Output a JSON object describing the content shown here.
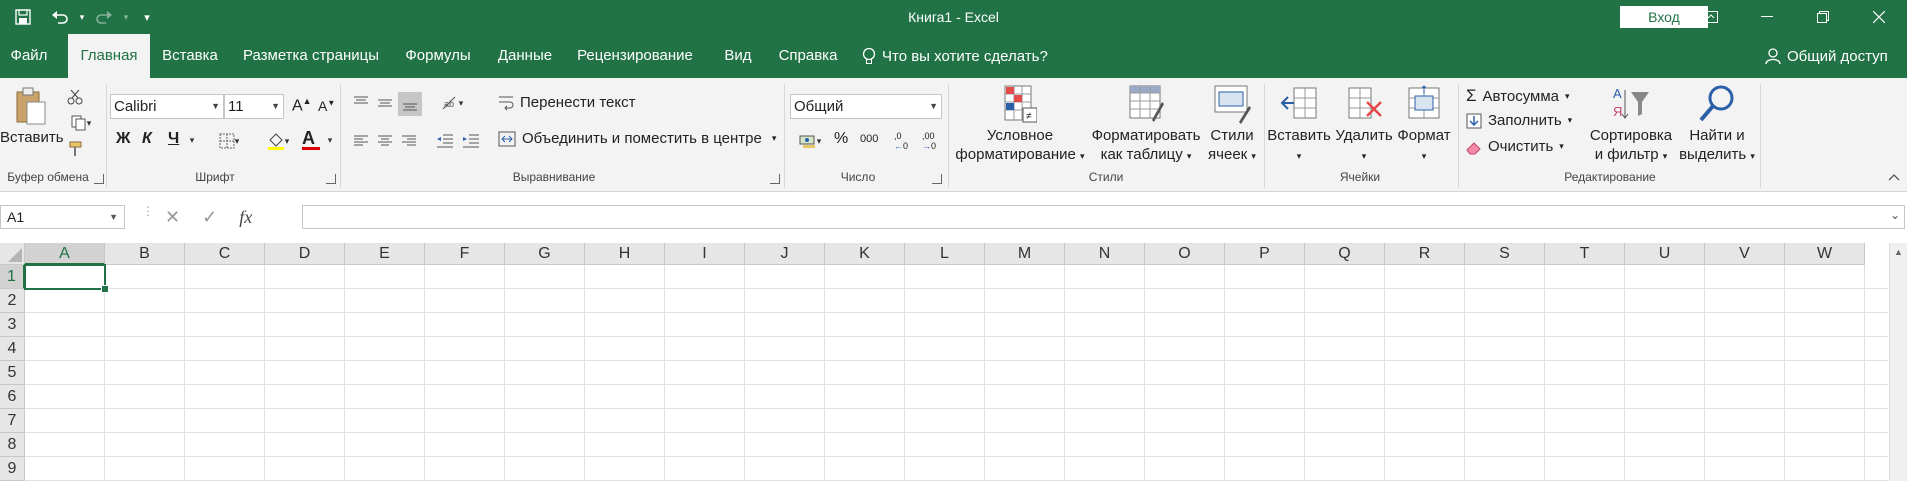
{
  "titlebar": {
    "title": "Книга1  -  Excel",
    "signin_label": "Вход",
    "qat_customize": "▾"
  },
  "tabs": [
    {
      "label": "Файл"
    },
    {
      "label": "Главная"
    },
    {
      "label": "Вставка"
    },
    {
      "label": "Разметка страницы"
    },
    {
      "label": "Формулы"
    },
    {
      "label": "Данные"
    },
    {
      "label": "Рецензирование"
    },
    {
      "label": "Вид"
    },
    {
      "label": "Справка"
    }
  ],
  "tell_me": "Что вы хотите сделать?",
  "share_label": "Общий доступ",
  "ribbon": {
    "clipboard": {
      "paste": "Вставить",
      "group": "Буфер обмена"
    },
    "font": {
      "name": "Calibri",
      "size": "11",
      "bold": "Ж",
      "italic": "К",
      "underline": "Ч",
      "grow": "A",
      "shrink": "A",
      "font_color": "A",
      "group": "Шрифт"
    },
    "alignment": {
      "wrap": "Перенести текст",
      "merge": "Объединить и поместить в центре",
      "group": "Выравнивание"
    },
    "number": {
      "format": "Общий",
      "percent": "%",
      "thousands": "000",
      "inc_dec": ",0",
      "dec_dec": ",00",
      "group": "Число"
    },
    "styles": {
      "conditional_1": "Условное",
      "conditional_2": "форматирование",
      "table_1": "Форматировать",
      "table_2": "как таблицу",
      "cell_1": "Стили",
      "cell_2": "ячеек",
      "group": "Стили"
    },
    "cells": {
      "insert": "Вставить",
      "delete": "Удалить",
      "format": "Формат",
      "group": "Ячейки"
    },
    "editing": {
      "autosum": "Автосумма",
      "fill": "Заполнить",
      "clear": "Очистить",
      "sort_1": "Сортировка",
      "sort_2": "и фильтр",
      "find_1": "Найти и",
      "find_2": "выделить",
      "group": "Редактирование"
    }
  },
  "formula_bar": {
    "name_box": "A1",
    "fx": "fx",
    "cancel": "✕",
    "enter": "✓",
    "value": ""
  },
  "columns": [
    "A",
    "B",
    "C",
    "D",
    "E",
    "F",
    "G",
    "H",
    "I",
    "J",
    "K",
    "L",
    "M",
    "N",
    "O",
    "P",
    "Q",
    "R",
    "S",
    "T",
    "U",
    "V",
    "W"
  ],
  "rows": [
    "1",
    "2",
    "3",
    "4",
    "5",
    "6",
    "7",
    "8",
    "9"
  ],
  "colors": {
    "accent": "#217346"
  }
}
